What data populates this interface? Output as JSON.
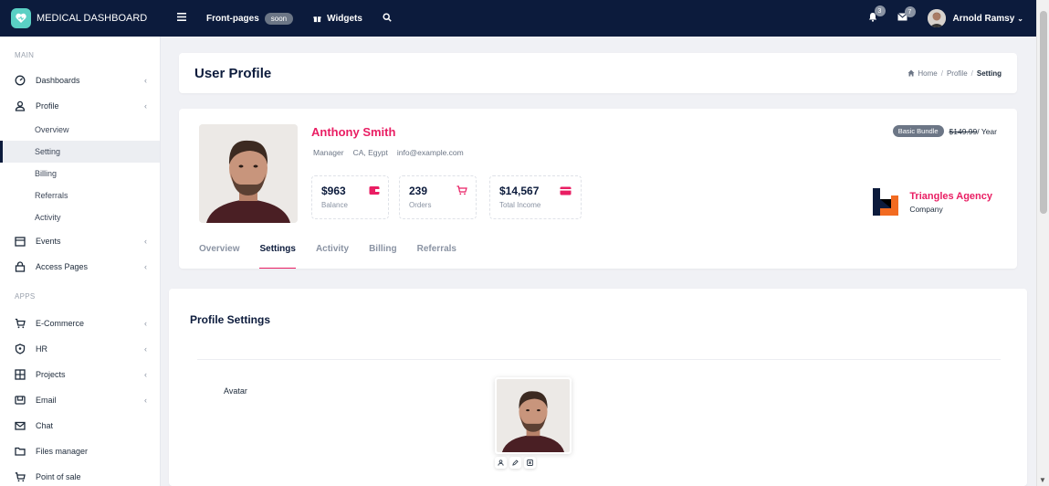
{
  "brand": {
    "name": "MEDICAL DASHBOARD"
  },
  "topbar": {
    "front_pages": "Front-pages",
    "soon": "soon",
    "widgets": "Widgets",
    "notif_count": "3",
    "mail_count": "7",
    "user_name": "Arnold Ramsy"
  },
  "sidebar": {
    "section_main": "MAIN",
    "section_apps": "APPS",
    "dashboards": "Dashboards",
    "profile": "Profile",
    "sub": [
      "Overview",
      "Setting",
      "Billing",
      "Referrals",
      "Activity"
    ],
    "events": "Events",
    "access": "Access Pages",
    "ecommerce": "E-Commerce",
    "hr": "HR",
    "projects": "Projects",
    "email": "Email",
    "chat": "Chat",
    "files": "Files manager",
    "pos": "Point of sale"
  },
  "header": {
    "title": "User Profile",
    "crumb_home": "Home",
    "crumb_profile": "Profile",
    "crumb_current": "Setting"
  },
  "profile": {
    "name": "Anthony Smith",
    "role": "Manager",
    "location": "CA, Egypt",
    "email": "info@example.com",
    "stats": [
      {
        "value": "$963",
        "label": "Balance"
      },
      {
        "value": "239",
        "label": "Orders"
      },
      {
        "value": "$14,567",
        "label": "Total Income"
      }
    ],
    "bundle_tag": "Basic Bundle",
    "bundle_price": "$149.99",
    "bundle_period": " / Year",
    "agency_name": "Triangles Agency",
    "agency_type": "Company",
    "tabs": [
      "Overview",
      "Settings",
      "Activity",
      "Billing",
      "Referrals"
    ]
  },
  "settings": {
    "title": "Profile Settings",
    "avatar_label": "Avatar"
  },
  "colors": {
    "accent": "#e91e63",
    "navy": "#0c1b3c"
  }
}
